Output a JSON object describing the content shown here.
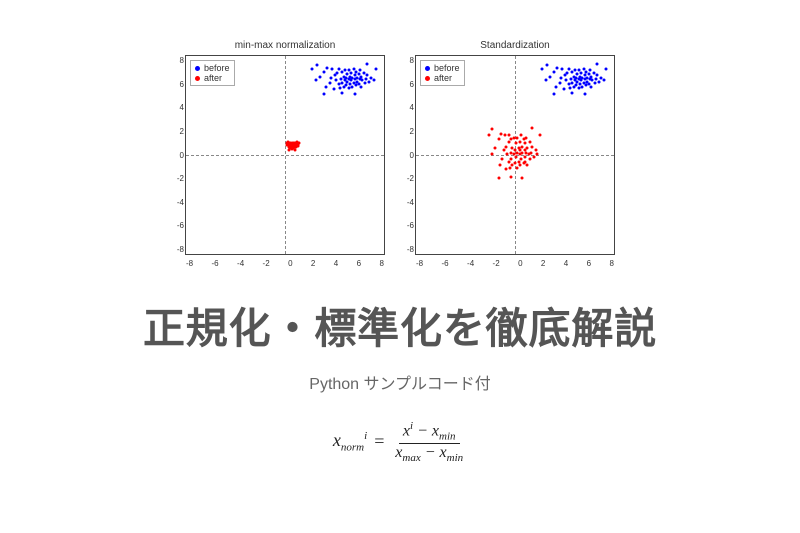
{
  "chart_data": [
    {
      "type": "scatter",
      "title": "min-max normalization",
      "xlim": [
        -8,
        8
      ],
      "ylim": [
        -8,
        8
      ],
      "xticks": [
        -8,
        -6,
        -4,
        -2,
        0,
        2,
        4,
        6,
        8
      ],
      "yticks": [
        -8,
        -6,
        -4,
        -2,
        0,
        2,
        4,
        6,
        8
      ],
      "legend": [
        "before",
        "after"
      ],
      "series": [
        {
          "name": "before",
          "color": "#0000ff",
          "points": [
            [
              2.1,
              6.8
            ],
            [
              2.4,
              5.9
            ],
            [
              2.7,
              6.2
            ],
            [
              3.0,
              6.6
            ],
            [
              3.2,
              5.4
            ],
            [
              3.3,
              6.9
            ],
            [
              3.5,
              5.7
            ],
            [
              3.6,
              6.1
            ],
            [
              3.7,
              6.8
            ],
            [
              3.8,
              5.2
            ],
            [
              3.9,
              6.3
            ],
            [
              4.0,
              5.9
            ],
            [
              4.1,
              6.5
            ],
            [
              4.2,
              5.6
            ],
            [
              4.2,
              6.8
            ],
            [
              4.3,
              5.3
            ],
            [
              4.4,
              6.0
            ],
            [
              4.5,
              6.6
            ],
            [
              4.5,
              5.7
            ],
            [
              4.6,
              6.2
            ],
            [
              4.6,
              5.4
            ],
            [
              4.7,
              6.7
            ],
            [
              4.7,
              5.9
            ],
            [
              4.8,
              6.1
            ],
            [
              4.8,
              5.5
            ],
            [
              4.9,
              6.4
            ],
            [
              4.9,
              5.8
            ],
            [
              5.0,
              6.0
            ],
            [
              5.0,
              6.7
            ],
            [
              5.0,
              5.3
            ],
            [
              5.1,
              6.2
            ],
            [
              5.1,
              5.6
            ],
            [
              5.2,
              6.5
            ],
            [
              5.2,
              5.9
            ],
            [
              5.3,
              6.1
            ],
            [
              5.3,
              5.4
            ],
            [
              5.4,
              6.8
            ],
            [
              5.4,
              5.7
            ],
            [
              5.5,
              6.0
            ],
            [
              5.5,
              6.3
            ],
            [
              5.6,
              5.5
            ],
            [
              5.6,
              6.6
            ],
            [
              5.7,
              5.8
            ],
            [
              5.7,
              6.1
            ],
            [
              5.8,
              6.4
            ],
            [
              5.8,
              5.6
            ],
            [
              5.9,
              6.0
            ],
            [
              5.9,
              6.7
            ],
            [
              6.0,
              5.4
            ],
            [
              6.0,
              6.2
            ],
            [
              6.1,
              5.9
            ],
            [
              6.2,
              6.5
            ],
            [
              6.3,
              5.7
            ],
            [
              6.4,
              6.0
            ],
            [
              6.5,
              6.3
            ],
            [
              6.6,
              5.8
            ],
            [
              6.8,
              6.1
            ],
            [
              7.0,
              5.9
            ],
            [
              3.0,
              4.8
            ],
            [
              4.5,
              4.9
            ],
            [
              5.5,
              4.8
            ],
            [
              6.5,
              7.2
            ],
            [
              2.5,
              7.1
            ],
            [
              7.2,
              6.8
            ]
          ]
        },
        {
          "name": "after",
          "color": "#ff0000",
          "points": [
            [
              0.05,
              0.9
            ],
            [
              0.1,
              0.7
            ],
            [
              0.15,
              0.75
            ],
            [
              0.2,
              0.85
            ],
            [
              0.22,
              0.55
            ],
            [
              0.24,
              0.92
            ],
            [
              0.28,
              0.62
            ],
            [
              0.3,
              0.72
            ],
            [
              0.32,
              0.88
            ],
            [
              0.34,
              0.48
            ],
            [
              0.36,
              0.78
            ],
            [
              0.38,
              0.68
            ],
            [
              0.4,
              0.82
            ],
            [
              0.42,
              0.58
            ],
            [
              0.42,
              0.9
            ],
            [
              0.44,
              0.5
            ],
            [
              0.46,
              0.7
            ],
            [
              0.48,
              0.84
            ],
            [
              0.48,
              0.62
            ],
            [
              0.5,
              0.75
            ],
            [
              0.5,
              0.54
            ],
            [
              0.52,
              0.86
            ],
            [
              0.52,
              0.68
            ],
            [
              0.54,
              0.72
            ],
            [
              0.54,
              0.56
            ],
            [
              0.56,
              0.8
            ],
            [
              0.56,
              0.65
            ],
            [
              0.58,
              0.7
            ],
            [
              0.58,
              0.88
            ],
            [
              0.58,
              0.5
            ],
            [
              0.6,
              0.75
            ],
            [
              0.6,
              0.58
            ],
            [
              0.62,
              0.82
            ],
            [
              0.62,
              0.68
            ],
            [
              0.64,
              0.72
            ],
            [
              0.64,
              0.54
            ],
            [
              0.66,
              0.9
            ],
            [
              0.66,
              0.62
            ],
            [
              0.68,
              0.7
            ],
            [
              0.68,
              0.78
            ],
            [
              0.7,
              0.56
            ],
            [
              0.7,
              0.85
            ],
            [
              0.72,
              0.65
            ],
            [
              0.72,
              0.72
            ],
            [
              0.74,
              0.8
            ],
            [
              0.74,
              0.58
            ],
            [
              0.76,
              0.7
            ],
            [
              0.76,
              0.88
            ],
            [
              0.78,
              0.54
            ],
            [
              0.78,
              0.75
            ],
            [
              0.8,
              0.68
            ],
            [
              0.82,
              0.82
            ],
            [
              0.84,
              0.62
            ],
            [
              0.86,
              0.7
            ],
            [
              0.88,
              0.78
            ],
            [
              0.9,
              0.65
            ],
            [
              0.94,
              0.72
            ],
            [
              0.98,
              0.68
            ],
            [
              0.2,
              0.35
            ],
            [
              0.48,
              0.38
            ],
            [
              0.68,
              0.35
            ],
            [
              0.88,
              0.98
            ],
            [
              0.12,
              0.95
            ],
            [
              1.0,
              0.9
            ]
          ]
        }
      ]
    },
    {
      "type": "scatter",
      "title": "Standardization",
      "xlim": [
        -8,
        8
      ],
      "ylim": [
        -8,
        8
      ],
      "xticks": [
        -8,
        -6,
        -4,
        -2,
        0,
        2,
        4,
        6,
        8
      ],
      "yticks": [
        -8,
        -6,
        -4,
        -2,
        0,
        2,
        4,
        6,
        8
      ],
      "legend": [
        "before",
        "after"
      ],
      "series": [
        {
          "name": "before",
          "color": "#0000ff",
          "points": [
            [
              2.1,
              6.8
            ],
            [
              2.4,
              5.9
            ],
            [
              2.7,
              6.2
            ],
            [
              3.0,
              6.6
            ],
            [
              3.2,
              5.4
            ],
            [
              3.3,
              6.9
            ],
            [
              3.5,
              5.7
            ],
            [
              3.6,
              6.1
            ],
            [
              3.7,
              6.8
            ],
            [
              3.8,
              5.2
            ],
            [
              3.9,
              6.3
            ],
            [
              4.0,
              5.9
            ],
            [
              4.1,
              6.5
            ],
            [
              4.2,
              5.6
            ],
            [
              4.2,
              6.8
            ],
            [
              4.3,
              5.3
            ],
            [
              4.4,
              6.0
            ],
            [
              4.5,
              6.6
            ],
            [
              4.5,
              5.7
            ],
            [
              4.6,
              6.2
            ],
            [
              4.6,
              5.4
            ],
            [
              4.7,
              6.7
            ],
            [
              4.7,
              5.9
            ],
            [
              4.8,
              6.1
            ],
            [
              4.8,
              5.5
            ],
            [
              4.9,
              6.4
            ],
            [
              4.9,
              5.8
            ],
            [
              5.0,
              6.0
            ],
            [
              5.0,
              6.7
            ],
            [
              5.0,
              5.3
            ],
            [
              5.1,
              6.2
            ],
            [
              5.1,
              5.6
            ],
            [
              5.2,
              6.5
            ],
            [
              5.2,
              5.9
            ],
            [
              5.3,
              6.1
            ],
            [
              5.3,
              5.4
            ],
            [
              5.4,
              6.8
            ],
            [
              5.4,
              5.7
            ],
            [
              5.5,
              6.0
            ],
            [
              5.5,
              6.3
            ],
            [
              5.6,
              5.5
            ],
            [
              5.6,
              6.6
            ],
            [
              5.7,
              5.8
            ],
            [
              5.7,
              6.1
            ],
            [
              5.8,
              6.4
            ],
            [
              5.8,
              5.6
            ],
            [
              5.9,
              6.0
            ],
            [
              5.9,
              6.7
            ],
            [
              6.0,
              5.4
            ],
            [
              6.0,
              6.2
            ],
            [
              6.1,
              5.9
            ],
            [
              6.2,
              6.5
            ],
            [
              6.3,
              5.7
            ],
            [
              6.4,
              6.0
            ],
            [
              6.5,
              6.3
            ],
            [
              6.6,
              5.8
            ],
            [
              6.8,
              6.1
            ],
            [
              7.0,
              5.9
            ],
            [
              3.0,
              4.8
            ],
            [
              4.5,
              4.9
            ],
            [
              5.5,
              4.8
            ],
            [
              6.5,
              7.2
            ],
            [
              2.5,
              7.1
            ],
            [
              7.2,
              6.8
            ]
          ]
        },
        {
          "name": "after",
          "color": "#ff0000",
          "points": [
            [
              -2.2,
              1.5
            ],
            [
              -1.9,
              0.0
            ],
            [
              -1.7,
              0.5
            ],
            [
              -1.4,
              1.2
            ],
            [
              -1.3,
              -0.9
            ],
            [
              -1.2,
              1.6
            ],
            [
              -1.1,
              -0.4
            ],
            [
              -1.0,
              0.3
            ],
            [
              -0.9,
              1.5
            ],
            [
              -0.8,
              -1.2
            ],
            [
              -0.8,
              0.6
            ],
            [
              -0.7,
              0.0
            ],
            [
              -0.6,
              1.0
            ],
            [
              -0.6,
              -0.6
            ],
            [
              -0.6,
              1.5
            ],
            [
              -0.5,
              -1.1
            ],
            [
              -0.4,
              0.1
            ],
            [
              -0.4,
              1.2
            ],
            [
              -0.4,
              -0.4
            ],
            [
              -0.3,
              0.5
            ],
            [
              -0.3,
              -0.9
            ],
            [
              -0.2,
              1.3
            ],
            [
              -0.2,
              0.0
            ],
            [
              -0.1,
              0.3
            ],
            [
              -0.1,
              -0.7
            ],
            [
              0.0,
              0.9
            ],
            [
              0.0,
              -0.2
            ],
            [
              0.1,
              0.1
            ],
            [
              0.1,
              1.3
            ],
            [
              0.1,
              -1.1
            ],
            [
              0.2,
              0.5
            ],
            [
              0.2,
              -0.6
            ],
            [
              0.3,
              1.0
            ],
            [
              0.3,
              0.0
            ],
            [
              0.3,
              0.3
            ],
            [
              0.3,
              -0.9
            ],
            [
              0.4,
              1.5
            ],
            [
              0.4,
              -0.4
            ],
            [
              0.5,
              0.1
            ],
            [
              0.5,
              0.6
            ],
            [
              0.6,
              -0.7
            ],
            [
              0.6,
              1.2
            ],
            [
              0.7,
              -0.2
            ],
            [
              0.7,
              0.3
            ],
            [
              0.7,
              0.9
            ],
            [
              0.7,
              -0.6
            ],
            [
              0.8,
              0.1
            ],
            [
              0.8,
              1.3
            ],
            [
              0.9,
              -0.9
            ],
            [
              0.9,
              0.5
            ],
            [
              1.0,
              0.0
            ],
            [
              1.1,
              1.0
            ],
            [
              1.1,
              -0.4
            ],
            [
              1.2,
              0.1
            ],
            [
              1.3,
              0.6
            ],
            [
              1.4,
              -0.2
            ],
            [
              1.6,
              0.3
            ],
            [
              1.7,
              0.0
            ],
            [
              -1.4,
              -1.9
            ],
            [
              -0.4,
              -1.8
            ],
            [
              0.5,
              -1.9
            ],
            [
              1.3,
              2.1
            ],
            [
              -1.9,
              2.0
            ],
            [
              1.9,
              1.5
            ]
          ]
        }
      ]
    }
  ],
  "headline": "正規化・標準化を徹底解説",
  "subline": "Python サンプルコード付",
  "formula": {
    "lhs_var": "x",
    "lhs_sub": "norm",
    "lhs_sup": "i",
    "num_left_var": "x",
    "num_left_sup": "i",
    "num_minus": " − ",
    "num_right_var": "x",
    "num_right_sub": "min",
    "den_left_var": "x",
    "den_left_sub": "max",
    "den_minus": " − ",
    "den_right_var": "x",
    "den_right_sub": "min",
    "eq": " = "
  }
}
